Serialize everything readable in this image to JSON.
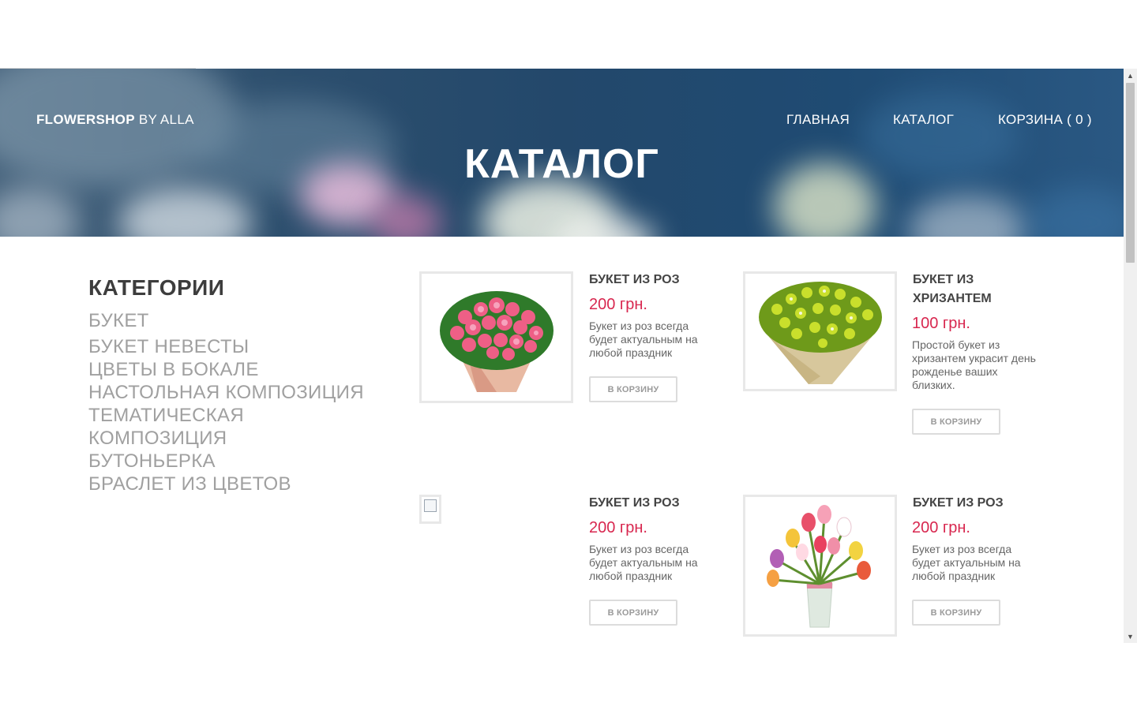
{
  "site": {
    "brand_bold": "FLOWERSHOP",
    "brand_rest": " BY ALLA",
    "nav": {
      "home": "ГЛАВНАЯ",
      "catalog": "КАТАЛОГ",
      "cart": "КОРЗИНА ( 0 )"
    },
    "hero_title": "КАТАЛОГ"
  },
  "sidebar": {
    "title": "КАТЕГОРИИ",
    "items": [
      "БУКЕТ",
      "БУКЕТ НЕВЕСТЫ",
      "ЦВЕТЫ В БОКАЛЕ",
      "НАСТОЛЬНАЯ КОМПОЗИЦИЯ",
      "ТЕМАТИЧЕСКАЯ",
      "КОМПОЗИЦИЯ",
      "БУТОНЬЕРКА",
      "БРАСЛЕТ ИЗ ЦВЕТОВ"
    ]
  },
  "products": [
    {
      "name": "БУКЕТ ИЗ РОЗ",
      "price": "200 грн.",
      "desc": "Букет из роз всегда будет актуальным на любой праздник",
      "button": "В КОРЗИНУ"
    },
    {
      "name": "БУКЕТ ИЗ ХРИЗАНТЕМ",
      "price": "100 грн.",
      "desc": "Простой букет из хризантем украсит день рожденье ваших близких.",
      "button": "В КОРЗИНУ"
    },
    {
      "name": "БУКЕТ ИЗ РОЗ",
      "price": "200 грн.",
      "desc": "Букет из роз всегда будет актуальным на любой праздник",
      "button": "В КОРЗИНУ"
    },
    {
      "name": "БУКЕТ ИЗ РОЗ",
      "price": "200 грн.",
      "desc": "Букет из роз всегда будет актуальным на любой праздник",
      "button": "В КОРЗИНУ"
    }
  ],
  "colors": {
    "price": "#d8274f",
    "hero": "#23486b"
  }
}
